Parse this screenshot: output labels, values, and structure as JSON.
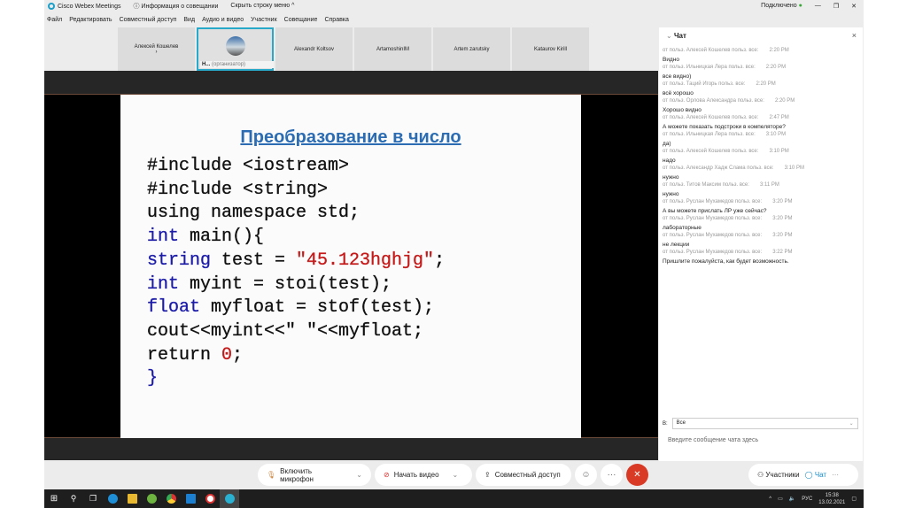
{
  "window": {
    "app_title": "Cisco Webex Meetings",
    "meeting_info": "Информация о совещании",
    "hide_menu": "Скрыть строку меню ^",
    "status": "Подключено",
    "minimize": "—",
    "restore": "❐",
    "close": "✕"
  },
  "menu": [
    "Файл",
    "Редактировать",
    "Совместный доступ",
    "Вид",
    "Аудио и видео",
    "Участник",
    "Совещание",
    "Справка"
  ],
  "participants": [
    {
      "name": "Алексей Кошелев",
      "sub": "›"
    },
    {
      "name": "Н...",
      "role": "(организатор)",
      "active": true
    },
    {
      "name": "Alexandr Koltsov"
    },
    {
      "name": "ArtamoshinIM"
    },
    {
      "name": "Artem zarutsky"
    },
    {
      "name": "Kataurov Kirill"
    }
  ],
  "slide": {
    "title": "Преобразование в число",
    "code": [
      [
        [
          "",
          "#include <iostream>"
        ]
      ],
      [
        [
          "",
          "#include <string>"
        ]
      ],
      [
        [
          "",
          "using namespace std;"
        ]
      ],
      [
        [
          "kw",
          "int"
        ],
        [
          "",
          " main(){"
        ]
      ],
      [
        [
          "kw",
          "string"
        ],
        [
          "",
          " test = "
        ],
        [
          "str",
          "\"45.123hghjg\""
        ],
        [
          "",
          ";"
        ]
      ],
      [
        [
          "kw",
          "int"
        ],
        [
          "",
          " myint = stoi(test);"
        ]
      ],
      [
        [
          "kw",
          "float"
        ],
        [
          "",
          " myfloat = stof(test);"
        ]
      ],
      [
        [
          "",
          "cout<<myint<<\" \"<<myfloat;"
        ]
      ],
      [
        [
          "",
          "return "
        ],
        [
          "num",
          "0"
        ],
        [
          "",
          ";"
        ]
      ],
      [
        [
          "kw",
          "}"
        ]
      ]
    ]
  },
  "controls": {
    "mic": "Включить микрофон",
    "video": "Начать видео",
    "share": "Совместный доступ",
    "more": "···",
    "end": "✕",
    "participants": "Участники",
    "chat": "Чат"
  },
  "chat": {
    "title": "Чат",
    "close": "×",
    "messages": [
      {
        "from": "от польз. Алексей Кошелев польз. все:",
        "time": "2:20 PM",
        "text": "Видно"
      },
      {
        "from": "от польз. Ильницкая Лера польз. все:",
        "time": "2:20 PM",
        "text": "все видно)"
      },
      {
        "from": "от польз. Таций Игорь польз. все:",
        "time": "2:20 PM",
        "text": "всё хорошо"
      },
      {
        "from": "от польз. Орлова Александра польз. все:",
        "time": "2:20 PM",
        "text": "Хорошо видно"
      },
      {
        "from": "от польз. Алексей Кошелев польз. все:",
        "time": "2:47 PM",
        "text": "А можете показать подстроки в компеляторе?"
      },
      {
        "from": "от польз. Ильницкая Лера польз. все:",
        "time": "3:10 PM",
        "text": "да)"
      },
      {
        "from": "от польз. Алексей Кошелев польз. все:",
        "time": "3:10 PM",
        "text": "надо"
      },
      {
        "from": "от польз. Александр Хадж Слама польз. все:",
        "time": "3:10 PM",
        "text": "нужно"
      },
      {
        "from": "от польз. Титов Максим польз. все:",
        "time": "3:11 PM",
        "text": "нужно"
      },
      {
        "from": "от польз. Руслан Мухамедов польз. все:",
        "time": "3:20 PM",
        "text": "А вы можете прислать ЛР уже сейчас?"
      },
      {
        "from": "от польз. Руслан Мухамедов польз. все:",
        "time": "3:20 PM",
        "text": "лабораторные"
      },
      {
        "from": "от польз. Руслан Мухамедов польз. все:",
        "time": "3:20 PM",
        "text": "не лекции"
      },
      {
        "from": "от польз. Руслан Мухамедов польз. все:",
        "time": "3:22 PM",
        "text": "Пришлите пожалуйста, как будет возможность."
      }
    ],
    "to_label": "В:",
    "to_value": "Все",
    "input_placeholder": "Введите сообщение чата здесь"
  },
  "taskbar": {
    "lang": "РУС",
    "time": "15:38",
    "date": "13.02.2021",
    "icons": [
      "start",
      "search",
      "task-view",
      "edge",
      "explorer",
      "utorrent",
      "chrome",
      "mail",
      "yandex",
      "webex"
    ]
  }
}
